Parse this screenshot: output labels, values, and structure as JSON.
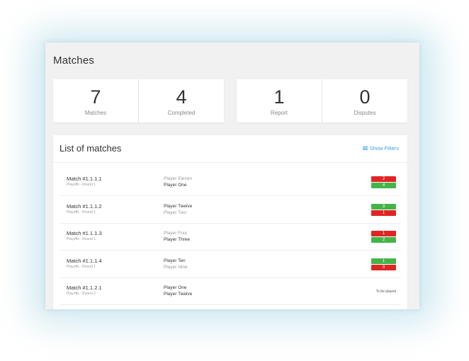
{
  "page": {
    "title": "Matches"
  },
  "stats": [
    {
      "value": "7",
      "label": "Matches"
    },
    {
      "value": "4",
      "label": "Completed"
    },
    {
      "value": "1",
      "label": "Report"
    },
    {
      "value": "0",
      "label": "Disputes"
    }
  ],
  "list": {
    "title": "List of matches",
    "filters_label": "Show Filters",
    "rows": [
      {
        "name": "Match #1.1.1.1",
        "sub": "Playoffs - Round 1",
        "player1": "Player Eleven",
        "player2": "Player One",
        "score1": "2",
        "score2": "4"
      },
      {
        "name": "Match #1.1.1.2",
        "sub": "Playoffs - Round 1",
        "player1": "Player Twelve",
        "player2": "Player Two",
        "score1": "3",
        "score2": "1"
      },
      {
        "name": "Match #1.1.1.3",
        "sub": "Playoffs - Round 1",
        "player1": "Player Four",
        "player2": "Player Three",
        "score1": "1",
        "score2": "2"
      },
      {
        "name": "Match #1.1.1.4",
        "sub": "Playoffs - Round 1",
        "player1": "Player Ten",
        "player2": "Player Nine",
        "score1": "1",
        "score2": "0"
      },
      {
        "name": "Match #1.1.2.1",
        "sub": "Playoffs - Round 2",
        "player1": "Player One",
        "player2": "Player Twelve",
        "status": "To be played"
      }
    ]
  },
  "colors": {
    "win": "#45b447",
    "loss": "#e02424",
    "link": "#3aa0dc",
    "glow": "#cfe9f1"
  }
}
